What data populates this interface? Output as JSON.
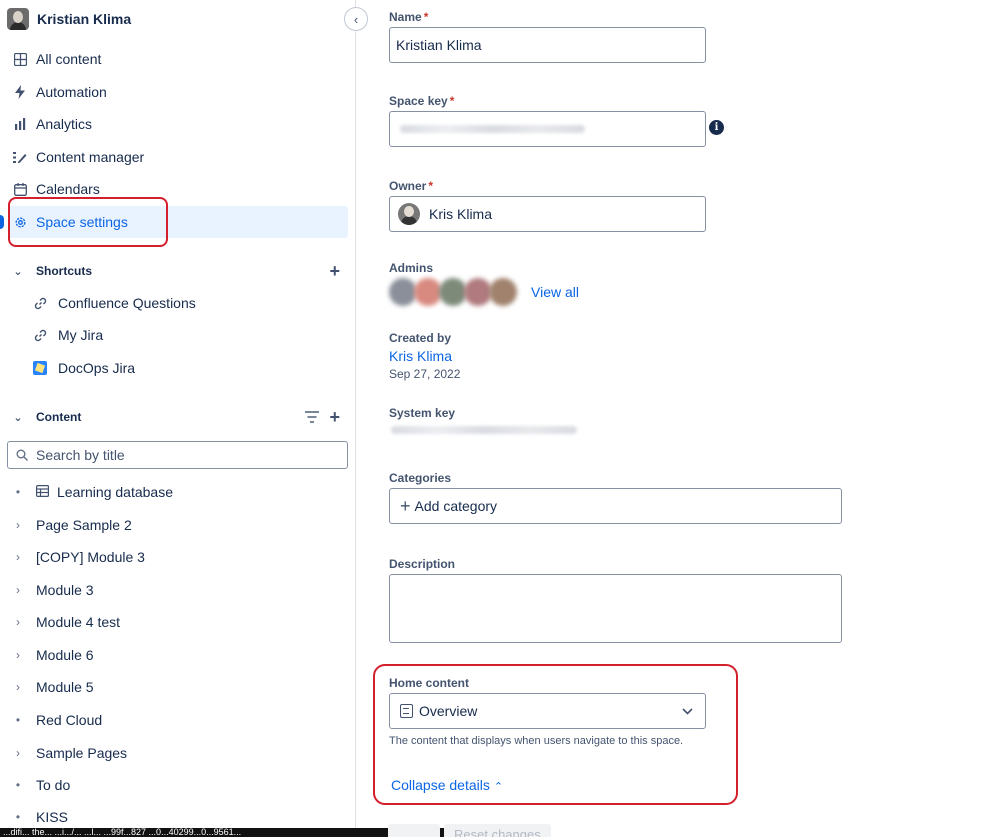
{
  "space": {
    "name": "Kristian Klima"
  },
  "sidebar": {
    "nav": [
      {
        "label": "All content",
        "icon": "grid-icon"
      },
      {
        "label": "Automation",
        "icon": "lightning-icon"
      },
      {
        "label": "Analytics",
        "icon": "bar-chart-icon"
      },
      {
        "label": "Content manager",
        "icon": "content-manager-icon"
      },
      {
        "label": "Calendars",
        "icon": "calendar-icon"
      },
      {
        "label": "Space settings",
        "icon": "gear-icon",
        "active": true
      }
    ],
    "shortcuts": {
      "title": "Shortcuts",
      "items": [
        {
          "label": "Confluence Questions",
          "icon": "link-icon"
        },
        {
          "label": "My Jira",
          "icon": "link-icon"
        },
        {
          "label": "DocOps Jira",
          "icon": "jira-icon"
        }
      ]
    },
    "content": {
      "title": "Content",
      "search_placeholder": "Search by title",
      "tree": [
        {
          "label": "Learning database",
          "lead": "bullet",
          "icon": "database-icon"
        },
        {
          "label": "Page Sample 2",
          "lead": "chevron"
        },
        {
          "label": "[COPY] Module 3",
          "lead": "chevron"
        },
        {
          "label": "Module 3",
          "lead": "chevron"
        },
        {
          "label": "Module 4 test",
          "lead": "chevron"
        },
        {
          "label": "Module 6",
          "lead": "chevron"
        },
        {
          "label": "Module 5",
          "lead": "chevron"
        },
        {
          "label": "Red Cloud",
          "lead": "bullet"
        },
        {
          "label": "Sample Pages",
          "lead": "chevron"
        },
        {
          "label": "To do",
          "lead": "bullet"
        },
        {
          "label": "KISS",
          "lead": "bullet"
        }
      ]
    }
  },
  "status_url": "...difi... the... ...i.../... ...l... ...99f...827 ...0...40299...0...9561...",
  "form": {
    "name": {
      "label": "Name",
      "required": "*",
      "value": "Kristian Klima"
    },
    "space_key": {
      "label": "Space key",
      "required": "*",
      "info_icon": "info-icon"
    },
    "owner": {
      "label": "Owner",
      "required": "*",
      "value": "Kris Klima"
    },
    "admins": {
      "label": "Admins",
      "view_all": "View all",
      "avatar_colors": [
        "#8a8f99",
        "#d98a80",
        "#7d8a7a",
        "#b07a7e",
        "#a0826d"
      ]
    },
    "created_by": {
      "label": "Created by",
      "user": "Kris Klima",
      "date": "Sep 27, 2022"
    },
    "system_key": {
      "label": "System key"
    },
    "categories": {
      "label": "Categories",
      "add_label": "Add category"
    },
    "description": {
      "label": "Description",
      "value": ""
    },
    "home_content": {
      "label": "Home content",
      "selected": "Overview",
      "helper": "The content that displays when users navigate to this space.",
      "collapse_label": "Collapse details"
    },
    "buttons": {
      "reset": "Reset changes"
    }
  },
  "colors": {
    "accent": "#0c66e4",
    "highlight": "#d4202c",
    "active_bg": "#e9f2ff"
  }
}
